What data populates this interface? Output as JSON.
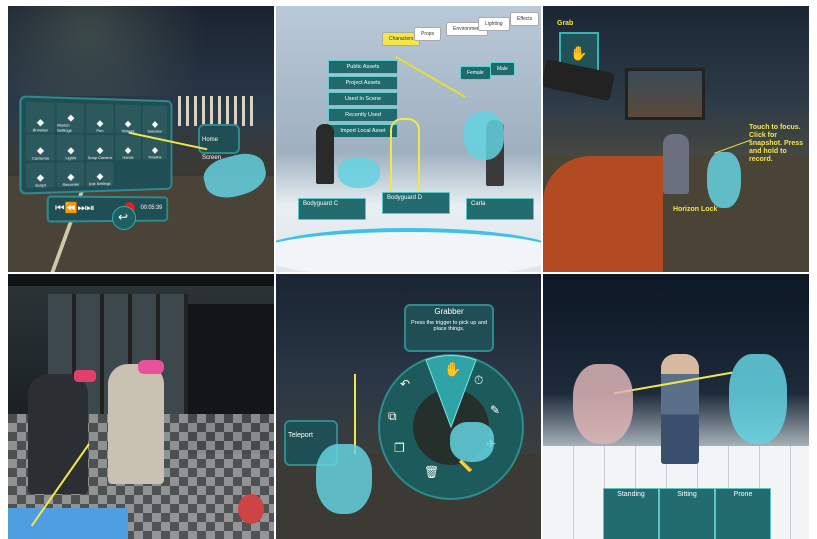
{
  "tile1": {
    "menu_items": [
      "Browser",
      "Sketch Settings",
      "Pen",
      "Shapes",
      "Selection",
      "Cameras",
      "Lights",
      "Snap Camera",
      "Hands",
      "Timeline",
      "Script",
      "Recorder",
      "Exit Settings"
    ],
    "time": "00:05:39",
    "home_screen": "Home Screen"
  },
  "tile2": {
    "tabs": [
      "Characters",
      "Props",
      "Environment",
      "Lighting",
      "Effects"
    ],
    "sub_tabs": [
      "Female",
      "Male"
    ],
    "asset_list": [
      "Public Assets",
      "Project Assets",
      "Used In Scene",
      "Recently Used",
      "Import Local Asset"
    ],
    "characters": [
      "Bodyguard C",
      "Bodyguard D",
      "Carla"
    ]
  },
  "tile3": {
    "grab": "Grab",
    "touch_label": "Touch to focus. Click for snapshot. Press and hold to record.",
    "horizon_lock": "Horizon Lock"
  },
  "tile5": {
    "grabber_title": "Grabber",
    "grabber_desc": "Press the trigger to pick up and place things.",
    "teleport": "Teleport"
  },
  "tile6": {
    "poses": [
      "Standing",
      "Sitting",
      "Prone"
    ]
  }
}
